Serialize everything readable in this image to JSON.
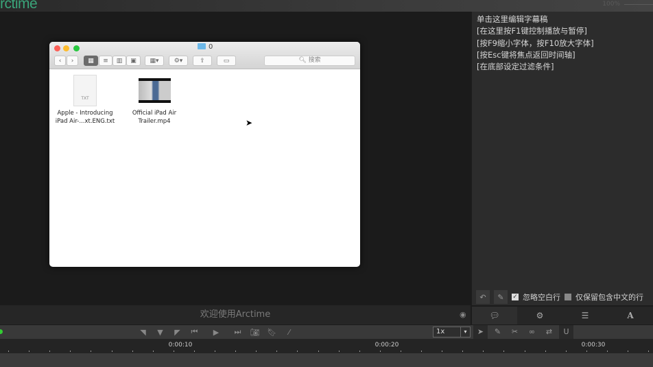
{
  "app": {
    "logo": "rctime",
    "zoom": "100%"
  },
  "finder": {
    "title": "0",
    "search_placeholder": "搜索",
    "files": [
      {
        "name": "Apple - Introducing iPad Air-...xt.ENG.txt",
        "type": "TXT"
      },
      {
        "name": "Official iPad Air Trailer.mp4"
      }
    ]
  },
  "subtitle_panel": {
    "lines": [
      "单击这里编辑字幕稿",
      "[在这里按F1键控制播放与暂停]",
      "[按F9缩小字体，按F10放大字体]",
      "[按Esc键将焦点返回时间轴]",
      "[在底部设定过滤条件]"
    ],
    "ignore_blank": "忽略空白行",
    "ignore_blank_checked": true,
    "chinese_only": "仅保留包含中文的行",
    "chinese_only_checked": false
  },
  "status": {
    "welcome": "欢迎使用Arctime"
  },
  "playback": {
    "speed": "1x"
  },
  "timeline": {
    "labels": [
      "0:00:10",
      "0:00:20",
      "0:00:30"
    ]
  },
  "colors": {
    "accent": "#3aa57a"
  }
}
